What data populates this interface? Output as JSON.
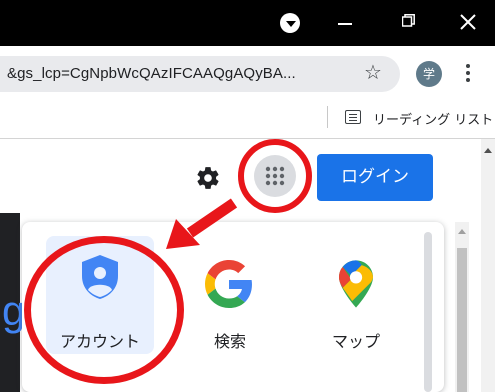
{
  "titlebar": {
    "controls": [
      "profile-dropdown",
      "minimize",
      "maximize",
      "close"
    ]
  },
  "omnibox": {
    "url": "&gs_lcp=CgNpbWcQAzIFCAAQgAQyBA..."
  },
  "profile": {
    "initial": "学"
  },
  "bookmarks_bar": {
    "reading_list_label": "リーディング リスト"
  },
  "header": {
    "login_label": "ログイン"
  },
  "apps_launcher": {
    "items": [
      {
        "label": "アカウント",
        "icon": "account-shield-icon",
        "selected": true
      },
      {
        "label": "検索",
        "icon": "google-g-icon",
        "selected": false
      },
      {
        "label": "マップ",
        "icon": "maps-pin-icon",
        "selected": false
      }
    ]
  },
  "annotations": {
    "ring_color": "#e8161a",
    "arrow_color": "#e8161a"
  },
  "colors": {
    "accent": "#1a73e8",
    "titlebar": "#000000",
    "highlight": "#e8f0fe"
  }
}
